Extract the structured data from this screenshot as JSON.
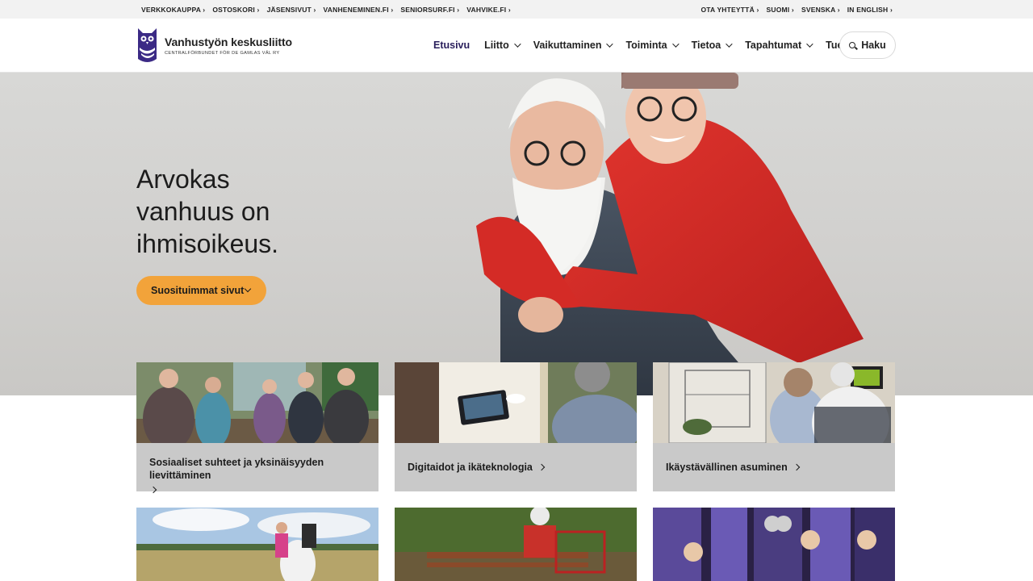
{
  "utility": {
    "left_links": [
      "VERKKOKAUPPA",
      "OSTOSKORI",
      "JÄSENSIVUT",
      "VANHENEMINEN.FI",
      "SENIORSURF.FI",
      "VAHVIKE.FI"
    ],
    "right_links": [
      "OTA YHTEYTTÄ",
      "SUOMI",
      "SVENSKA",
      "IN ENGLISH"
    ]
  },
  "logo": {
    "name": "Vanhustyön keskusliitto",
    "sub": "CENTRALFÖRBUNDET FÖR DE GAMLAS VÄL RY"
  },
  "nav": {
    "items": [
      "Etusivu",
      "Liitto",
      "Vaikuttaminen",
      "Toiminta",
      "Tietoa",
      "Tapahtumat",
      "Tue"
    ],
    "search_label": "Haku"
  },
  "hero": {
    "heading": "Arvokas vanhuus on ihmisoikeus.",
    "cta_label": "Suosituimmat sivut"
  },
  "cards": [
    {
      "label": "Sosiaaliset suhteet ja yksinäisyyden lievittäminen"
    },
    {
      "label": "Digitaidot ja ikäteknologia"
    },
    {
      "label": "Ikäystävällinen asuminen"
    }
  ],
  "colors": {
    "brand_purple": "#3b2a85",
    "cta_orange": "#f2a33a",
    "card_gray": "#c9c9c9"
  }
}
